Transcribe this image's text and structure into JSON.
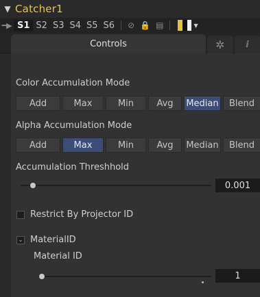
{
  "header": {
    "collapse_icon": "chevron-down-icon",
    "title": "Catcher1"
  },
  "versions": {
    "pin_icon": "pin-icon",
    "tabs": [
      {
        "label": "S1",
        "active": true
      },
      {
        "label": "S2",
        "active": false
      },
      {
        "label": "S3",
        "active": false
      },
      {
        "label": "S4",
        "active": false
      },
      {
        "label": "S5",
        "active": false
      },
      {
        "label": "S6",
        "active": false
      }
    ],
    "disable_icon": "disable-icon",
    "lock_icon": "lock-icon",
    "save_icon": "save-icon",
    "color_swatch": [
      "#e2c43a",
      "#111111",
      "#f0f0f0"
    ]
  },
  "tabs": {
    "controls": "Controls",
    "settings_icon": "gear-icon",
    "info_icon": "info-icon"
  },
  "color_accum": {
    "label": "Color Accumulation Mode",
    "options": [
      "Add",
      "Max",
      "Min",
      "Avg",
      "Median",
      "Blend"
    ],
    "selected": "Median"
  },
  "alpha_accum": {
    "label": "Alpha Accumulation Mode",
    "options": [
      "Add",
      "Max",
      "Min",
      "Avg",
      "Median",
      "Blend"
    ],
    "selected": "Max"
  },
  "threshold": {
    "label": "Accumulation Threshhold",
    "value": "0.001",
    "slider_fraction": 0.001
  },
  "restrict": {
    "label": "Restrict By Projector ID",
    "checked": false
  },
  "material": {
    "checkbox_label": "MaterialID",
    "checked": true,
    "field_label": "Material ID",
    "value": "1"
  }
}
